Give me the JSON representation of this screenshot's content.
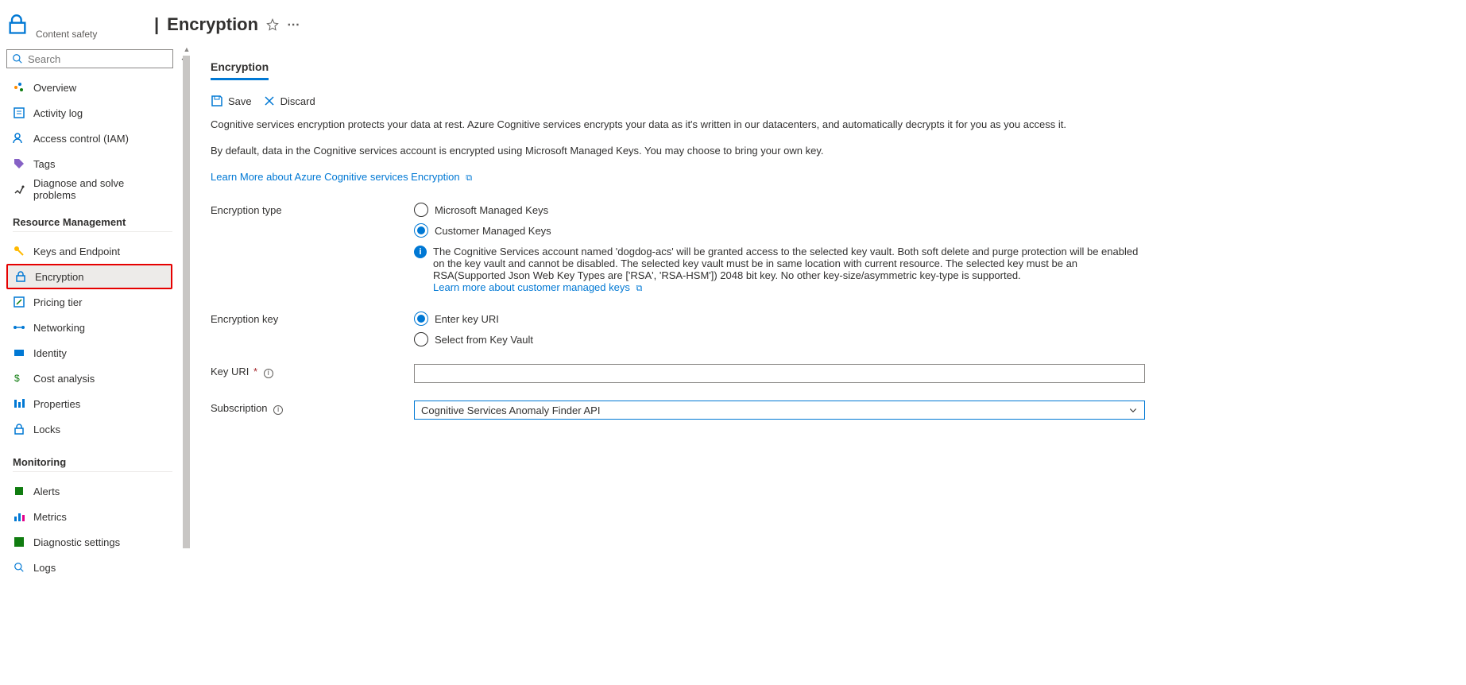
{
  "header": {
    "page_title_prefix": "|",
    "page_title": "Encryption",
    "subtitle": "Content safety"
  },
  "sidebar": {
    "search_placeholder": "Search",
    "items_top": [
      {
        "label": "Overview"
      },
      {
        "label": "Activity log"
      },
      {
        "label": "Access control (IAM)"
      },
      {
        "label": "Tags"
      },
      {
        "label": "Diagnose and solve problems"
      }
    ],
    "section_resource": "Resource Management",
    "items_resource": [
      {
        "label": "Keys and Endpoint"
      },
      {
        "label": "Encryption"
      },
      {
        "label": "Pricing tier"
      },
      {
        "label": "Networking"
      },
      {
        "label": "Identity"
      },
      {
        "label": "Cost analysis"
      },
      {
        "label": "Properties"
      },
      {
        "label": "Locks"
      }
    ],
    "section_monitoring": "Monitoring",
    "items_monitoring": [
      {
        "label": "Alerts"
      },
      {
        "label": "Metrics"
      },
      {
        "label": "Diagnostic settings"
      },
      {
        "label": "Logs"
      }
    ]
  },
  "main": {
    "tab": "Encryption",
    "toolbar": {
      "save": "Save",
      "discard": "Discard"
    },
    "desc1": "Cognitive services encryption protects your data at rest. Azure Cognitive services encrypts your data as it's written in our datacenters, and automatically decrypts it for you as you access it.",
    "desc2": "By default, data in the Cognitive services account is encrypted using Microsoft Managed Keys. You may choose to bring your own key.",
    "learn_more": "Learn More about Azure Cognitive services Encryption",
    "form": {
      "encryption_type_label": "Encryption type",
      "encryption_type_opts": [
        "Microsoft Managed Keys",
        "Customer Managed Keys"
      ],
      "cmk_info": "The Cognitive Services account named 'dogdog-acs' will be granted access to the selected key vault. Both soft delete and purge protection will be enabled on the key vault and cannot be disabled. The selected key vault must be in same location with current resource. The selected key must be an RSA(Supported Json Web Key Types are ['RSA', 'RSA-HSM']) 2048 bit key. No other key-size/asymmetric key-type is supported.",
      "cmk_learn_more": "Learn more about customer managed keys",
      "encryption_key_label": "Encryption key",
      "encryption_key_opts": [
        "Enter key URI",
        "Select from Key Vault"
      ],
      "key_uri_label": "Key URI",
      "key_uri_value": "",
      "subscription_label": "Subscription",
      "subscription_value": "Cognitive Services Anomaly Finder API"
    }
  }
}
